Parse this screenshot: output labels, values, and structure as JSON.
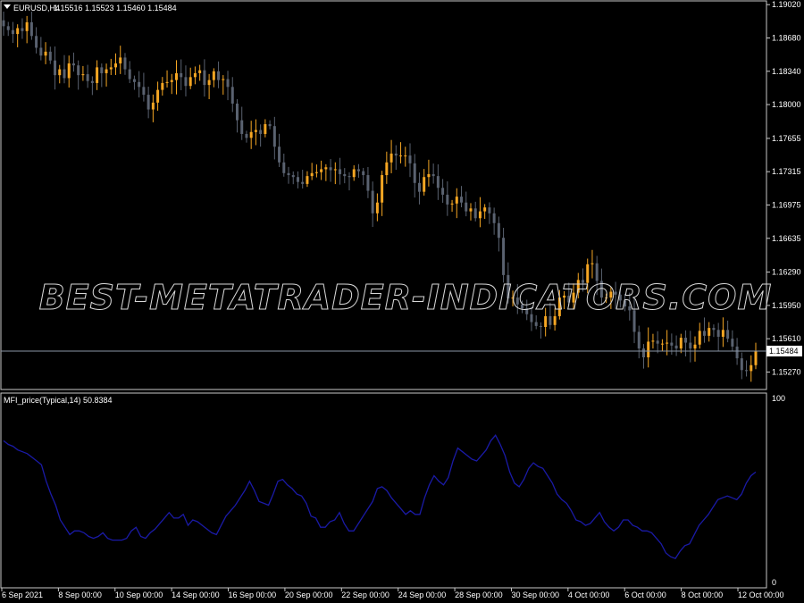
{
  "main_header": {
    "symbol": "EURUSD,H4",
    "ohlc": "1.15516 1.15523 1.15460 1.15484"
  },
  "sub_header": {
    "indicator": "MFI_price(Typical,14) 50.8384"
  },
  "watermark": "BEST-METATRADER-INDICATORS.COM",
  "colors": {
    "bull": "#f5a623",
    "bear": "#5a6270",
    "mfi_line": "#1a1aa6",
    "frame": "#c8c8c8",
    "bid_line": "#8a96a6"
  },
  "chart_data": [
    {
      "type": "candlestick",
      "symbol": "EURUSD",
      "timeframe": "H4",
      "ylim": [
        1.1511,
        1.1904
      ],
      "y_ticks": [
        "1.19020",
        "1.18680",
        "1.18340",
        "1.18000",
        "1.17655",
        "1.17315",
        "1.16975",
        "1.16635",
        "1.16290",
        "1.15950",
        "1.15610",
        "1.15270"
      ],
      "current_price_label": "1.15484",
      "current_price": 1.15484,
      "x_ticks": [
        "6 Sep 2021",
        "8 Sep 00:00",
        "10 Sep 00:00",
        "14 Sep 00:00",
        "16 Sep 00:00",
        "20 Sep 00:00",
        "22 Sep 00:00",
        "24 Sep 00:00",
        "28 Sep 00:00",
        "30 Sep 00:00",
        "4 Oct 00:00",
        "6 Oct 00:00",
        "8 Oct 00:00",
        "12 Oct 00:00"
      ],
      "close": [
        1.188,
        1.1876,
        1.1872,
        1.1878,
        1.1875,
        1.1884,
        1.187,
        1.1858,
        1.185,
        1.1854,
        1.1845,
        1.183,
        1.1836,
        1.1827,
        1.1842,
        1.184,
        1.183,
        1.1831,
        1.1824,
        1.1822,
        1.1838,
        1.1832,
        1.1836,
        1.1838,
        1.1842,
        1.1848,
        1.1836,
        1.1826,
        1.1823,
        1.1818,
        1.181,
        1.1795,
        1.1802,
        1.1815,
        1.1822,
        1.1823,
        1.1825,
        1.1832,
        1.1828,
        1.1819,
        1.1828,
        1.1832,
        1.1835,
        1.182,
        1.1825,
        1.1834,
        1.1825,
        1.1826,
        1.1818,
        1.1801,
        1.1784,
        1.177,
        1.1766,
        1.1772,
        1.1774,
        1.177,
        1.178,
        1.1778,
        1.1757,
        1.1741,
        1.173,
        1.1728,
        1.1726,
        1.1721,
        1.1719,
        1.1727,
        1.173,
        1.1731,
        1.1734,
        1.1736,
        1.1733,
        1.1734,
        1.1729,
        1.1727,
        1.1726,
        1.1734,
        1.1732,
        1.1728,
        1.1712,
        1.1689,
        1.17,
        1.1728,
        1.1741,
        1.175,
        1.1748,
        1.1748,
        1.1748,
        1.174,
        1.172,
        1.1711,
        1.1726,
        1.1729,
        1.1727,
        1.1715,
        1.1708,
        1.1698,
        1.1699,
        1.1706,
        1.17,
        1.1691,
        1.1694,
        1.1684,
        1.1691,
        1.1695,
        1.1689,
        1.1679,
        1.1664,
        1.1626,
        1.1602,
        1.1603,
        1.1596,
        1.1592,
        1.1586,
        1.1578,
        1.1574,
        1.1573,
        1.1584,
        1.1575,
        1.1584,
        1.1603,
        1.1605,
        1.1598,
        1.1608,
        1.1621,
        1.1618,
        1.1637,
        1.1638,
        1.162,
        1.1603,
        1.1603,
        1.1609,
        1.1606,
        1.16,
        1.1594,
        1.159,
        1.1568,
        1.1551,
        1.1542,
        1.1558,
        1.1559,
        1.1556,
        1.1556,
        1.1557,
        1.1554,
        1.1551,
        1.1562,
        1.1557,
        1.1551,
        1.1555,
        1.1569,
        1.1564,
        1.1572,
        1.157,
        1.1563,
        1.157,
        1.1561,
        1.1553,
        1.1541,
        1.1529,
        1.1528,
        1.1534,
        1.1548
      ],
      "mfi": {
        "name": "MFI_price(Typical,14)",
        "last_value": 50.8384,
        "ylim": [
          0,
          100
        ],
        "y_ticks": [
          "100",
          "0"
        ],
        "values": [
          77,
          75,
          74,
          72,
          71,
          70,
          68,
          66,
          64,
          55,
          48,
          42,
          34,
          30,
          26,
          28,
          28,
          27,
          25,
          24,
          25,
          27,
          24,
          23,
          23,
          23,
          24,
          28,
          30,
          25,
          24,
          27,
          29,
          32,
          35,
          38,
          35,
          35,
          37,
          31,
          34,
          33,
          31,
          29,
          27,
          26,
          31,
          36,
          39,
          42,
          46,
          50,
          55,
          50,
          44,
          43,
          42,
          48,
          55,
          56,
          53,
          51,
          48,
          47,
          43,
          36,
          35,
          30,
          30,
          33,
          34,
          38,
          32,
          28,
          28,
          32,
          36,
          40,
          44,
          51,
          52,
          50,
          46,
          43,
          40,
          37,
          39,
          37,
          37,
          46,
          53,
          58,
          55,
          53,
          57,
          66,
          73,
          71,
          69,
          67,
          66,
          69,
          72,
          77,
          80,
          75,
          69,
          60,
          54,
          52,
          56,
          62,
          65,
          63,
          62,
          58,
          54,
          48,
          45,
          43,
          39,
          34,
          33,
          31,
          32,
          35,
          38,
          33,
          30,
          28,
          30,
          34,
          34,
          31,
          30,
          28,
          28,
          27,
          24,
          21,
          16,
          14,
          13,
          17,
          20,
          21,
          26,
          31,
          34,
          37,
          41,
          45,
          46,
          47,
          46,
          45,
          48,
          54,
          58,
          60
        ]
      }
    }
  ]
}
